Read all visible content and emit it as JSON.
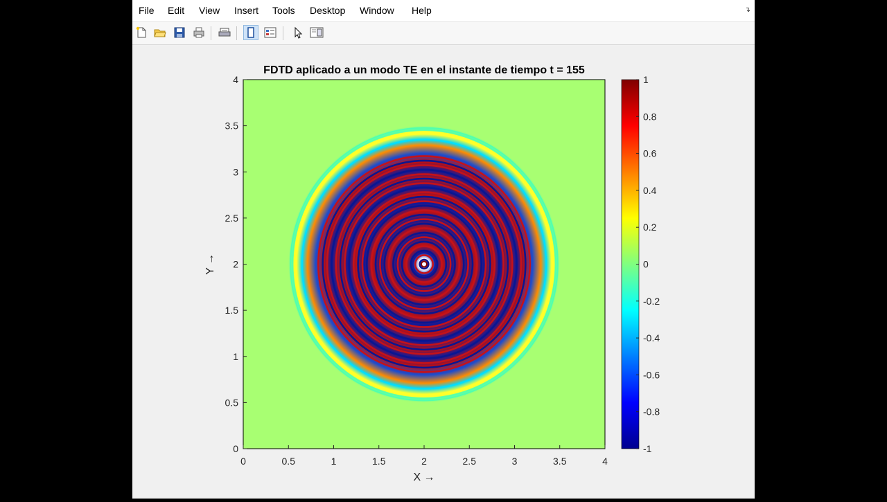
{
  "menubar": {
    "items": [
      "File",
      "Edit",
      "View",
      "Insert",
      "Tools",
      "Desktop",
      "Window",
      "Help"
    ]
  },
  "toolbar": {
    "buttons": [
      {
        "icon": "new-figure-icon"
      },
      {
        "icon": "open-file-icon"
      },
      {
        "icon": "save-icon"
      },
      {
        "icon": "print-icon"
      },
      {
        "icon": "print-preview-icon"
      },
      {
        "icon": "hide-plot-tools-icon",
        "pressed": true
      },
      {
        "icon": "show-plot-tools-icon"
      },
      {
        "icon": "edit-plot-pointer-icon"
      },
      {
        "icon": "dock-panel-icon"
      }
    ]
  },
  "chart_data": {
    "type": "heatmap",
    "title": "FDTD aplicado a un modo TE en el instante de tiempo t = 155",
    "xlabel": "X →",
    "ylabel": "Y →",
    "xlim": [
      0,
      4
    ],
    "ylim": [
      0,
      4
    ],
    "xticks": [
      0,
      0.5,
      1,
      1.5,
      2,
      2.5,
      3,
      3.5,
      4
    ],
    "xtick_labels": [
      "0",
      "0.5",
      "1",
      "1.5",
      "2",
      "2.5",
      "3",
      "3.5",
      "4"
    ],
    "yticks": [
      0,
      0.5,
      1,
      1.5,
      2,
      2.5,
      3,
      3.5,
      4
    ],
    "ytick_labels": [
      "0",
      "0.5",
      "1",
      "1.5",
      "2",
      "2.5",
      "3",
      "3.5",
      "4"
    ],
    "colormap": "jet",
    "clim": [
      -1,
      1
    ],
    "colorbar_ticks": [
      1,
      0.8,
      0.6,
      0.4,
      0.2,
      0,
      -0.2,
      -0.4,
      -0.6,
      -0.8,
      -1
    ],
    "colorbar_tick_labels": [
      "1",
      "0.8",
      "0.6",
      "0.4",
      "0.2",
      "0",
      "-0.2",
      "-0.4",
      "-0.6",
      "-0.8",
      "-1"
    ],
    "background_value": 0.1,
    "source_center": [
      2,
      2
    ],
    "wavefront_radius": 1.5,
    "colors": {
      "background_green": "#a8ff72",
      "outer_ring_yellow": "#ffff2a",
      "ring_cyan": "#4fffb0"
    }
  }
}
